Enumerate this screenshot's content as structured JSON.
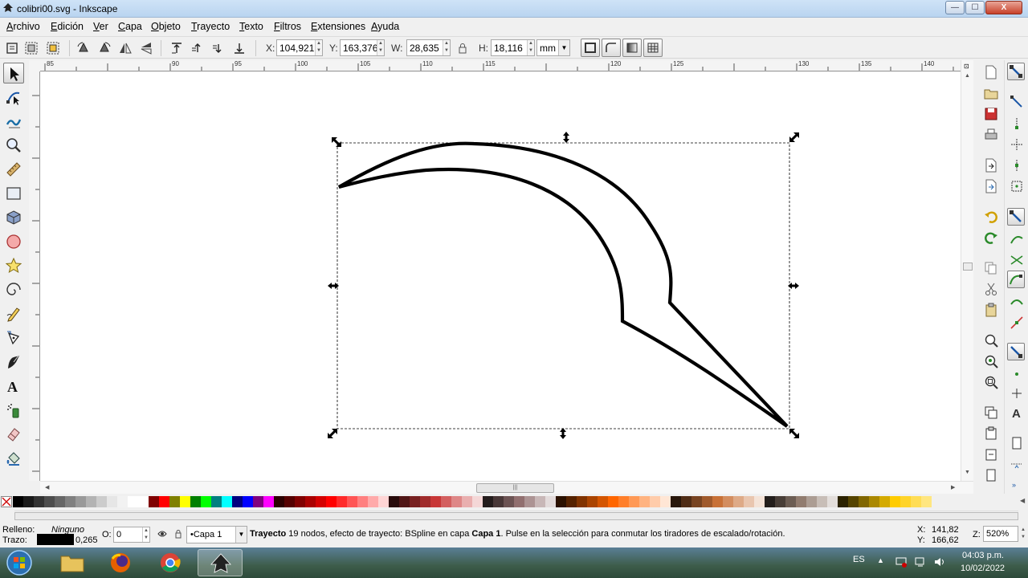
{
  "window": {
    "title": "colibri00.svg - Inkscape",
    "controls": {
      "minimize": "—",
      "maximize": "☐",
      "close": "X"
    }
  },
  "menu": [
    "Archivo",
    "Edición",
    "Ver",
    "Capa",
    "Objeto",
    "Trayecto",
    "Texto",
    "Filtros",
    "Extensiones",
    "Ayuda"
  ],
  "tool_controls": {
    "x_label": "X:",
    "x_value": "104,921",
    "y_label": "Y:",
    "y_value": "163,376",
    "w_label": "W:",
    "w_value": "28,635",
    "h_label": "H:",
    "h_value": "18,116",
    "unit": "mm"
  },
  "toolbox": {
    "tools": [
      "selector-tool",
      "node-tool",
      "tweak-tool",
      "zoom-tool",
      "measure-tool",
      "rectangle-tool",
      "3d-box-tool",
      "ellipse-tool",
      "star-tool",
      "spiral-tool",
      "pencil-tool",
      "pen-tool",
      "calligraphy-tool",
      "text-tool",
      "spray-tool",
      "eraser-tool",
      "paint-bucket-tool"
    ],
    "active": "selector-tool"
  },
  "rulers": {
    "top_labels": [
      "85",
      "90",
      "95",
      "100",
      "105",
      "110",
      "115",
      "120",
      "125",
      "130",
      "135",
      "140"
    ],
    "left_labels": [
      "175",
      "180",
      "175",
      "170",
      "165",
      "160"
    ]
  },
  "palette": {
    "colors": [
      "#000000",
      "#1a1a1a",
      "#333333",
      "#4d4d4d",
      "#666666",
      "#808080",
      "#999999",
      "#b3b3b3",
      "#cccccc",
      "#e6e6e6",
      "#f2f2f2",
      "#ffffff",
      "#ffffff",
      "#800000",
      "#ff0000",
      "#808000",
      "#ffff00",
      "#008000",
      "#00ff00",
      "#008080",
      "#00ffff",
      "#000080",
      "#0000ff",
      "#800080",
      "#ff00ff",
      "#2b0000",
      "#550000",
      "#800000",
      "#aa0000",
      "#d40000",
      "#ff0000",
      "#ff2a2a",
      "#ff5555",
      "#ff8080",
      "#ffaaaa",
      "#ffd5d5",
      "#280b0b",
      "#501616",
      "#782121",
      "#a02c2c",
      "#c83737",
      "#d35f5f",
      "#de8787",
      "#e9afaf",
      "#f4d7d7",
      "#241c1c",
      "#483737",
      "#6c5353",
      "#916f6f",
      "#ac9393",
      "#c8b7b7",
      "#e3dbdb",
      "#2b1100",
      "#552200",
      "#803300",
      "#aa4400",
      "#d45500",
      "#ff6600",
      "#ff7f2a",
      "#ff9955",
      "#ffb380",
      "#ffccaa",
      "#ffe6d5",
      "#28170b",
      "#502d16",
      "#784421",
      "#a05a2c",
      "#c87137",
      "#d38d5f",
      "#deaa87",
      "#e9c6af",
      "#f4e3d7",
      "#241f1c",
      "#483e37",
      "#6c5d53",
      "#917c6f",
      "#ac9d93",
      "#c8beb7",
      "#e3dedb",
      "#2b2200",
      "#554400",
      "#806600",
      "#aa8800",
      "#d4aa00",
      "#ffcc00",
      "#ffd42a",
      "#ffdd55",
      "#ffe680"
    ]
  },
  "status": {
    "fill_label": "Relleno:",
    "fill_value": "Ninguno",
    "stroke_label": "Trazo:",
    "stroke_width": "0,265",
    "opacity_label": "O:",
    "opacity_value": "0",
    "layer": "•Capa 1",
    "message_bold1": "Trayecto",
    "message_1": " 19 nodos, efecto de trayecto: BSpline en capa ",
    "message_bold2": "Capa 1",
    "message_2": ". Pulse en la selección para conmutar los tiradores de escalado/rotación.",
    "cursor_x_label": "X:",
    "cursor_x": "141,82",
    "cursor_y_label": "Y:",
    "cursor_y": "166,62",
    "zoom_label": "Z:",
    "zoom": "520%"
  },
  "taskbar": {
    "language": "ES",
    "time": "04:03 p.m.",
    "date": "10/02/2022"
  },
  "colors": {
    "selection_handle": "#000000",
    "stroke": "#000000",
    "canvas": "#ffffff"
  }
}
